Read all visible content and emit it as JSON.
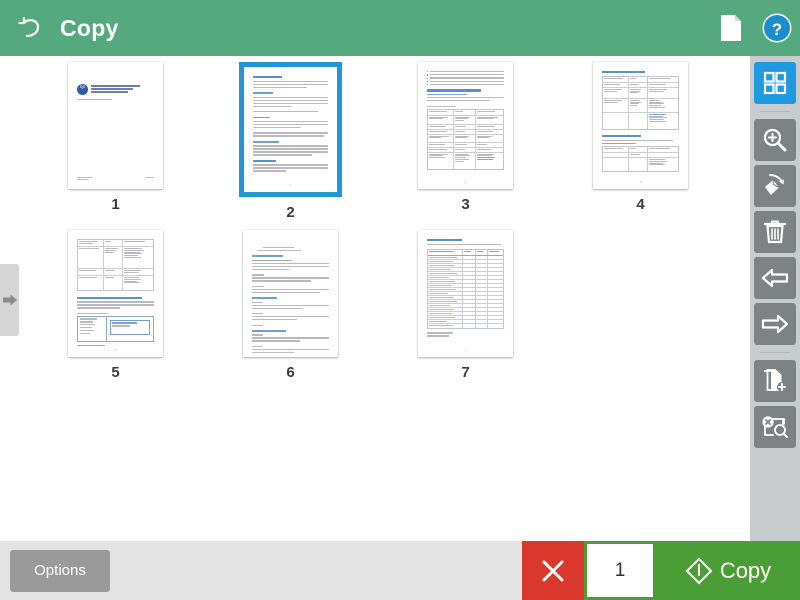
{
  "header": {
    "title": "Copy",
    "back_icon": "back-arrow-icon",
    "document_icon": "document-page-icon",
    "help_icon": "help-question-circle-icon",
    "background_color": "#55a97f"
  },
  "left_panel_handle": {
    "icon": "arrow-right-icon"
  },
  "pages": [
    {
      "label": "1",
      "selected": false,
      "type": "title-page"
    },
    {
      "label": "2",
      "selected": true,
      "type": "text-page"
    },
    {
      "label": "3",
      "selected": false,
      "type": "list-table-page"
    },
    {
      "label": "4",
      "selected": false,
      "type": "two-table-page"
    },
    {
      "label": "5",
      "selected": false,
      "type": "table-figure-page"
    },
    {
      "label": "6",
      "selected": false,
      "type": "sections-page"
    },
    {
      "label": "7",
      "selected": false,
      "type": "big-table-page"
    }
  ],
  "toolbar": {
    "items": [
      {
        "name": "grid-view-button",
        "icon": "grid-2x2-icon",
        "active": true,
        "separator_after": true
      },
      {
        "name": "zoom-in-button",
        "icon": "magnifier-plus-icon",
        "active": false,
        "separator_after": false
      },
      {
        "name": "rotate-page-button",
        "icon": "rotate-page-icon",
        "active": false,
        "separator_after": false
      },
      {
        "name": "delete-page-button",
        "icon": "trash-can-icon",
        "active": false,
        "separator_after": false
      },
      {
        "name": "move-left-button",
        "icon": "arrow-left-outline-icon",
        "active": false,
        "separator_after": false
      },
      {
        "name": "move-right-button",
        "icon": "arrow-right-outline-icon",
        "active": false,
        "separator_after": true
      },
      {
        "name": "add-pages-button",
        "icon": "add-pages-icon",
        "active": false,
        "separator_after": false
      },
      {
        "name": "clear-preview-button",
        "icon": "cancel-search-icon",
        "active": false,
        "separator_after": false
      }
    ],
    "background_color": "#c8ccce",
    "active_color": "#1f9ae0",
    "button_color": "#7d8285"
  },
  "bottom": {
    "options_label": "Options",
    "cancel_icon": "close-x-icon",
    "copy_count": "1",
    "copy_label": "Copy",
    "start_icon": "start-diamond-icon",
    "cancel_color": "#d9392c",
    "copy_color": "#4a9e35"
  }
}
